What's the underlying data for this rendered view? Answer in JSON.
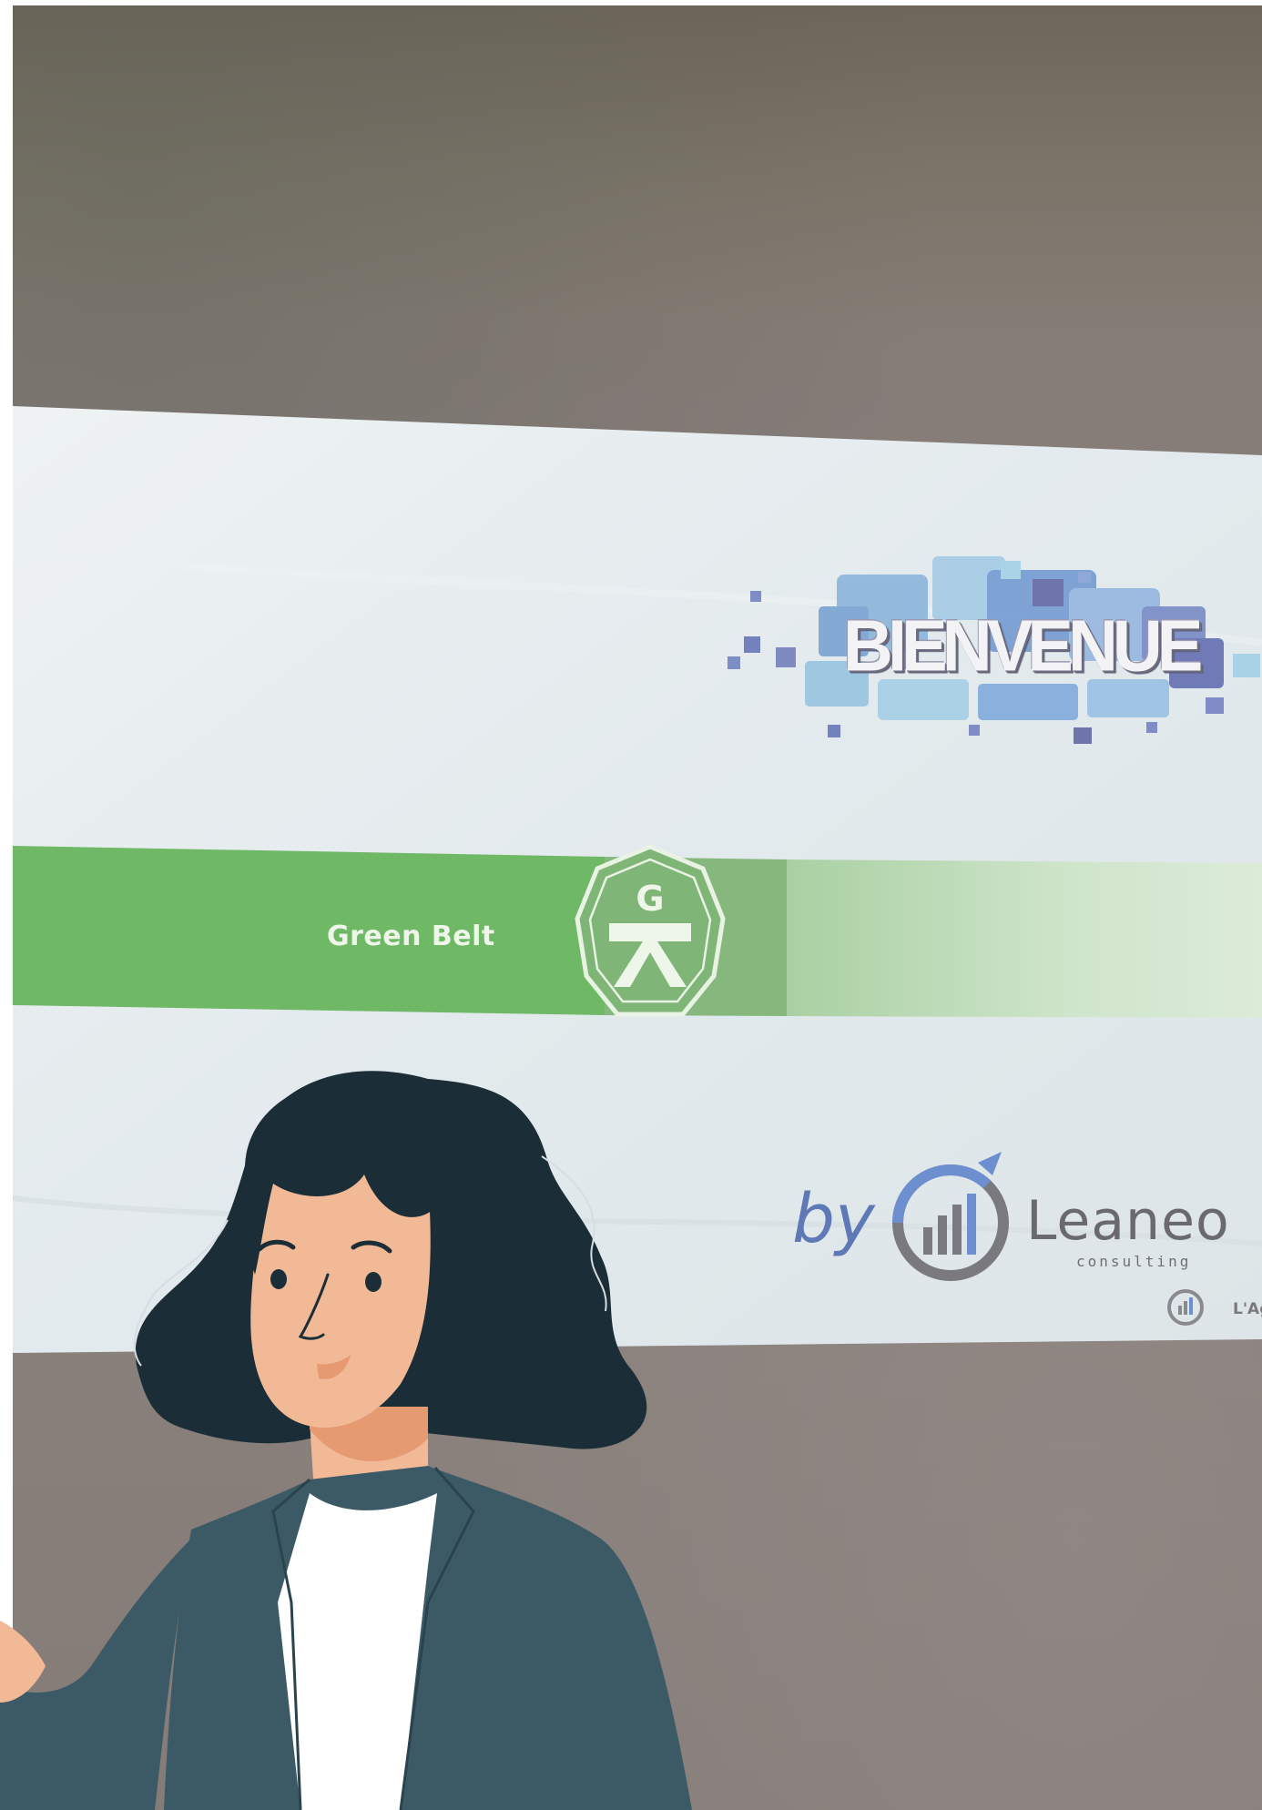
{
  "slide": {
    "welcome": "BIENVENUE",
    "course": "Green Belt",
    "badge_letter": "G",
    "byline": "by",
    "brand": "Leaneo",
    "tagline": "consulting",
    "footer_brand": "L'Ag"
  },
  "colors": {
    "wall": "#857c78",
    "screen": "#e6ecef",
    "green_band": "#6fb866",
    "badge_band": "#86b87e",
    "light_band": "#c9e1c4",
    "welcome_blue": "#6b75b5",
    "brand_blue": "#5f78b6",
    "hair": "#1b2d36",
    "skin": "#f2b996",
    "blazer": "#3b5a66",
    "shirt": "#ffffff"
  },
  "icons": {
    "welcome_logo": "bienvenue-squares-logo",
    "badge": "green-belt-octagon-badge",
    "brand_logo": "leaneo-chart-logo",
    "illustration": "presenter-woman-illustration"
  }
}
